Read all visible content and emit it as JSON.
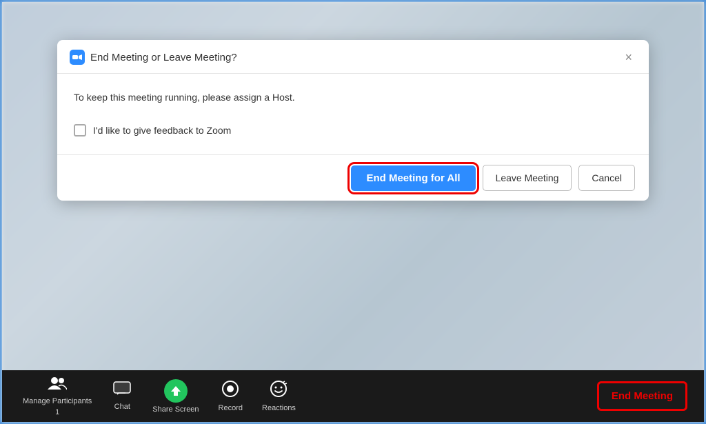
{
  "background": {
    "color": "#c8d8e8"
  },
  "dialog": {
    "title": "End Meeting or Leave Meeting?",
    "message": "To keep this meeting running, please assign a Host.",
    "checkbox_label": "I'd like to give feedback to Zoom",
    "btn_end_all": "End Meeting for All",
    "btn_leave": "Leave Meeting",
    "btn_cancel": "Cancel",
    "close_label": "×"
  },
  "toolbar": {
    "participants_label": "Manage Participants",
    "participants_count": "1",
    "chat_label": "Chat",
    "share_screen_label": "Share Screen",
    "record_label": "Record",
    "reactions_label": "Reactions",
    "end_meeting_label": "End Meeting"
  }
}
